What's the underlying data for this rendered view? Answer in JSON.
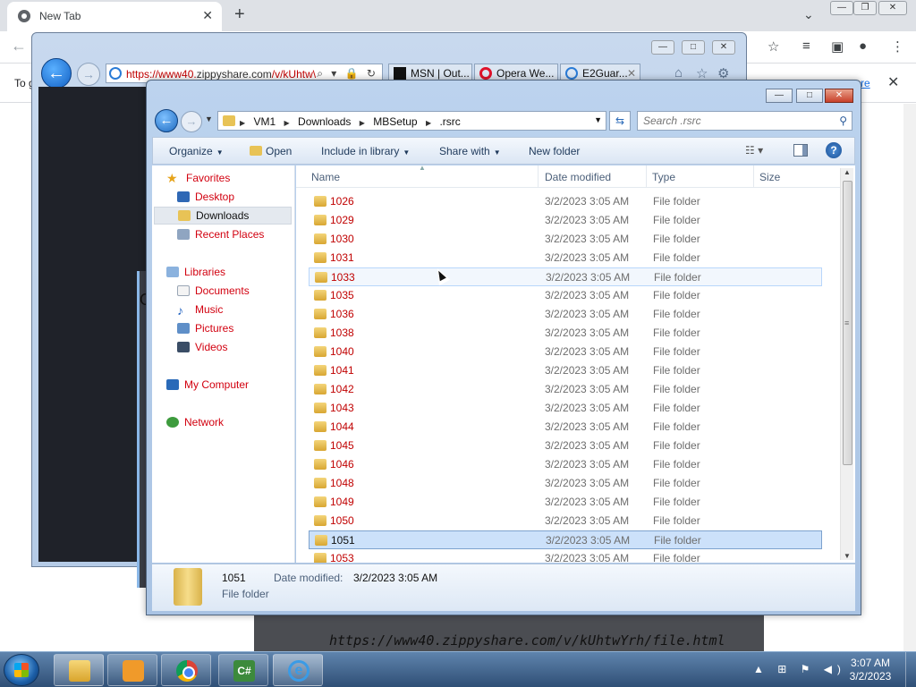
{
  "chrome": {
    "tab_title": "New Tab",
    "tab_close": "✕",
    "new_tab": "+",
    "infobar_text": "To g",
    "infobar_link": "re",
    "infobar_close": "✕"
  },
  "ie": {
    "url_red": "https://www40.",
    "url_dark": "zippyshare.com",
    "url_rest": "/v/kUhtw\\",
    "url_tools": "⌕ ▾ 🔒 ↻",
    "tabs": [
      {
        "label": "MSN | Out..."
      },
      {
        "label": "Opera We..."
      },
      {
        "label": "E2Guar..."
      }
    ],
    "dialog_text": "O("
  },
  "page": {
    "url_caption": "https://www40.zippyshare.com/v/kUhtwYrh/file.html"
  },
  "explorer": {
    "breadcrumb": [
      "VM1",
      "Downloads",
      "MBSetup",
      ".rsrc"
    ],
    "search_placeholder": "Search .rsrc",
    "commands": {
      "organize": "Organize",
      "open": "Open",
      "include": "Include in library",
      "share": "Share with",
      "new_folder": "New folder"
    },
    "nav": {
      "favorites": "Favorites",
      "desktop": "Desktop",
      "downloads": "Downloads",
      "recent": "Recent Places",
      "libraries": "Libraries",
      "documents": "Documents",
      "music": "Music",
      "pictures": "Pictures",
      "videos": "Videos",
      "computer": "My Computer",
      "network": "Network"
    },
    "columns": {
      "name": "Name",
      "date": "Date modified",
      "type": "Type",
      "size": "Size"
    },
    "rows": [
      {
        "name": "1026",
        "date": "3/2/2023 3:05 AM",
        "type": "File folder"
      },
      {
        "name": "1029",
        "date": "3/2/2023 3:05 AM",
        "type": "File folder"
      },
      {
        "name": "1030",
        "date": "3/2/2023 3:05 AM",
        "type": "File folder"
      },
      {
        "name": "1031",
        "date": "3/2/2023 3:05 AM",
        "type": "File folder"
      },
      {
        "name": "1033",
        "date": "3/2/2023 3:05 AM",
        "type": "File folder"
      },
      {
        "name": "1035",
        "date": "3/2/2023 3:05 AM",
        "type": "File folder"
      },
      {
        "name": "1036",
        "date": "3/2/2023 3:05 AM",
        "type": "File folder"
      },
      {
        "name": "1038",
        "date": "3/2/2023 3:05 AM",
        "type": "File folder"
      },
      {
        "name": "1040",
        "date": "3/2/2023 3:05 AM",
        "type": "File folder"
      },
      {
        "name": "1041",
        "date": "3/2/2023 3:05 AM",
        "type": "File folder"
      },
      {
        "name": "1042",
        "date": "3/2/2023 3:05 AM",
        "type": "File folder"
      },
      {
        "name": "1043",
        "date": "3/2/2023 3:05 AM",
        "type": "File folder"
      },
      {
        "name": "1044",
        "date": "3/2/2023 3:05 AM",
        "type": "File folder"
      },
      {
        "name": "1045",
        "date": "3/2/2023 3:05 AM",
        "type": "File folder"
      },
      {
        "name": "1046",
        "date": "3/2/2023 3:05 AM",
        "type": "File folder"
      },
      {
        "name": "1048",
        "date": "3/2/2023 3:05 AM",
        "type": "File folder"
      },
      {
        "name": "1049",
        "date": "3/2/2023 3:05 AM",
        "type": "File folder"
      },
      {
        "name": "1050",
        "date": "3/2/2023 3:05 AM",
        "type": "File folder"
      },
      {
        "name": "1051",
        "date": "3/2/2023 3:05 AM",
        "type": "File folder"
      },
      {
        "name": "1053",
        "date": "3/2/2023 3:05 AM",
        "type": "File folder"
      }
    ],
    "hover_row_name": "1033",
    "selected_row_name": "1051",
    "details": {
      "name": "1051",
      "date_label": "Date modified:",
      "date_value": "3/2/2023 3:05 AM",
      "type": "File folder"
    }
  },
  "taskbar": {
    "cs_label": "C#",
    "ie_label": "e",
    "time": "3:07 AM",
    "date": "3/2/2023"
  }
}
